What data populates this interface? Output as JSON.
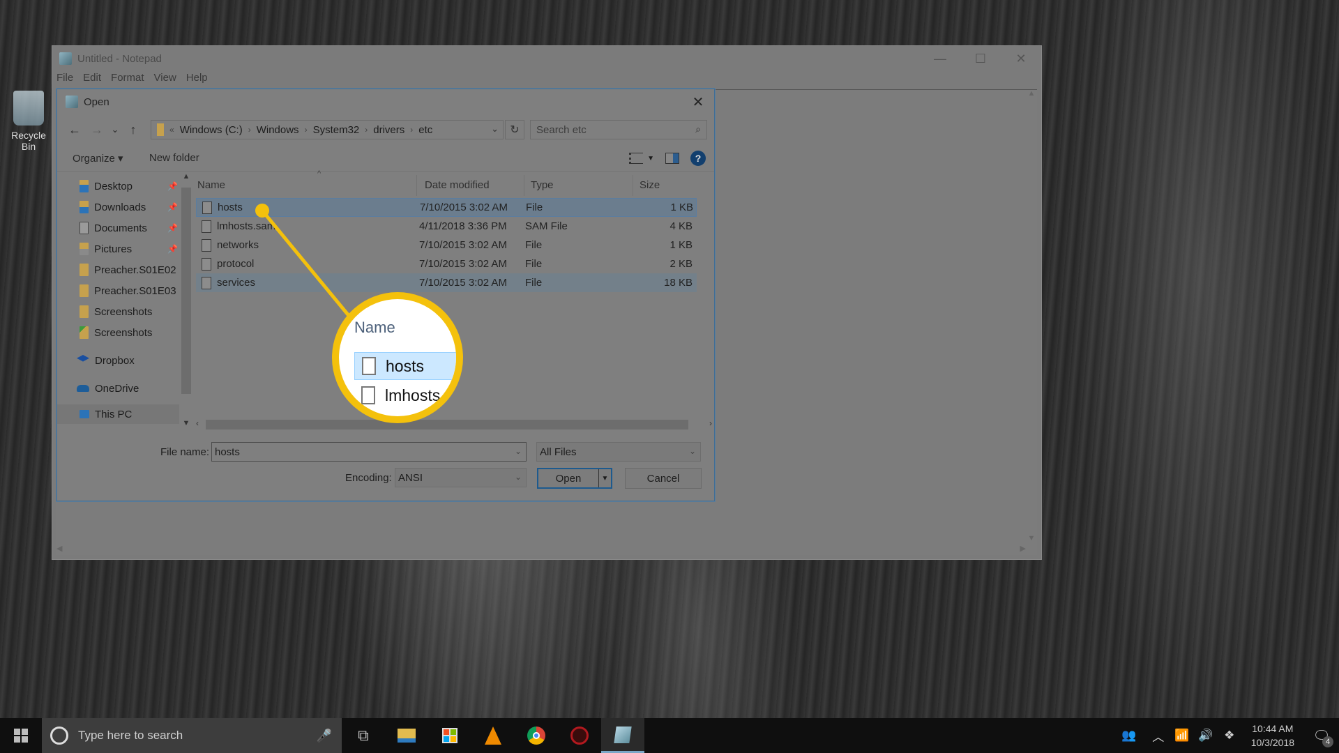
{
  "desktop": {
    "recycle_bin_label": "Recycle Bin"
  },
  "notepad": {
    "title": "Untitled - Notepad",
    "menu": [
      "File",
      "Edit",
      "Format",
      "View",
      "Help"
    ],
    "controls": {
      "minimize": "—",
      "maximize": "☐",
      "close": "✕"
    }
  },
  "dialog": {
    "title": "Open",
    "close_glyph": "✕",
    "nav": {
      "back": "←",
      "forward": "→",
      "recent": "⌄",
      "up": "↑"
    },
    "address": {
      "overflow": "«",
      "crumbs": [
        "Windows (C:)",
        "Windows",
        "System32",
        "drivers",
        "etc"
      ],
      "sep": "›",
      "dropdown": "⌄"
    },
    "refresh_glyph": "↻",
    "search": {
      "placeholder": "Search etc",
      "icon": "⌕"
    },
    "commands": {
      "organize": "Organize ▾",
      "new_folder": "New folder",
      "help": "?"
    },
    "nav_pane": {
      "items": [
        {
          "label": "Desktop",
          "icon": "desktop-folder",
          "pinned": true
        },
        {
          "label": "Downloads",
          "icon": "downloads-folder",
          "pinned": true
        },
        {
          "label": "Documents",
          "icon": "documents-folder",
          "pinned": true
        },
        {
          "label": "Pictures",
          "icon": "pictures-folder",
          "pinned": true
        },
        {
          "label": "Preacher.S01E02",
          "icon": "folder",
          "pinned": false
        },
        {
          "label": "Preacher.S01E03",
          "icon": "folder",
          "pinned": false
        },
        {
          "label": "Screenshots",
          "icon": "folder",
          "pinned": false
        },
        {
          "label": "Screenshots",
          "icon": "synced-folder",
          "pinned": false
        },
        {
          "label": "Dropbox",
          "icon": "dropbox",
          "pinned": false
        },
        {
          "label": "OneDrive",
          "icon": "onedrive",
          "pinned": false
        },
        {
          "label": "This PC",
          "icon": "this-pc",
          "pinned": false
        }
      ],
      "pin_glyph": "📌"
    },
    "columns": {
      "name": "Name",
      "date": "Date modified",
      "type": "Type",
      "size": "Size"
    },
    "files": [
      {
        "name": "hosts",
        "date": "7/10/2015 3:02 AM",
        "type": "File",
        "size": "1 KB",
        "selected": true
      },
      {
        "name": "lmhosts.sam",
        "date": "4/11/2018 3:36 PM",
        "type": "SAM File",
        "size": "4 KB",
        "selected": false
      },
      {
        "name": "networks",
        "date": "7/10/2015 3:02 AM",
        "type": "File",
        "size": "1 KB",
        "selected": false
      },
      {
        "name": "protocol",
        "date": "7/10/2015 3:02 AM",
        "type": "File",
        "size": "2 KB",
        "selected": false
      },
      {
        "name": "services",
        "date": "7/10/2015 3:02 AM",
        "type": "File",
        "size": "18 KB",
        "selected": false,
        "hover": true
      }
    ],
    "file_name_label": "File name:",
    "file_name_value": "hosts",
    "file_type_value": "All Files",
    "encoding_label": "Encoding:",
    "encoding_value": "ANSI",
    "open_label": "Open",
    "cancel_label": "Cancel"
  },
  "annotation": {
    "color": "#f4c10c",
    "magnifier": {
      "header": "Name",
      "rows": [
        "hosts",
        "lmhosts.s"
      ]
    }
  },
  "taskbar": {
    "search_placeholder": "Type here to search",
    "apps": [
      "task-view",
      "file-explorer",
      "microsoft-store",
      "vlc",
      "chrome",
      "antivirus",
      "notepad"
    ],
    "time": "10:44 AM",
    "date": "10/3/2018",
    "notifications_count": "4"
  }
}
